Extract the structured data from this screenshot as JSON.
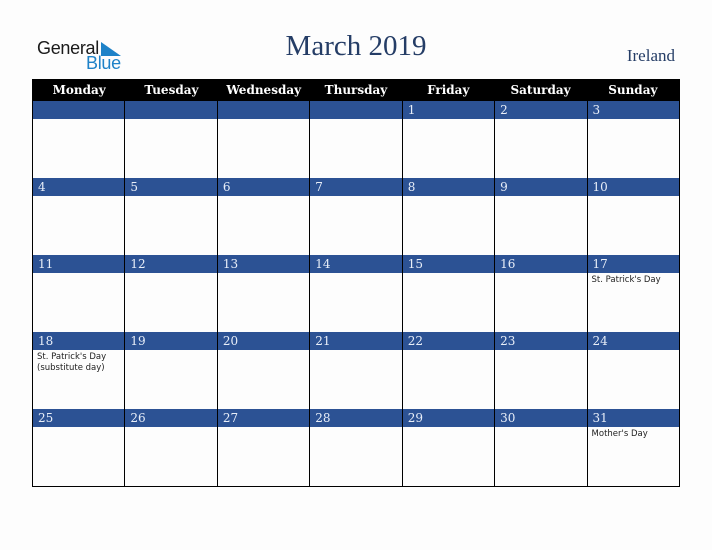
{
  "logo": {
    "line1": "General",
    "line2": "Blue"
  },
  "title": "March 2019",
  "country": "Ireland",
  "weekdays": [
    "Monday",
    "Tuesday",
    "Wednesday",
    "Thursday",
    "Friday",
    "Saturday",
    "Sunday"
  ],
  "colors": {
    "header_bg": "#000000",
    "day_bar": "#2c5294",
    "title": "#253d66",
    "logo_blue": "#1e82c8"
  },
  "weeks": [
    [
      {
        "day": "",
        "event": ""
      },
      {
        "day": "",
        "event": ""
      },
      {
        "day": "",
        "event": ""
      },
      {
        "day": "",
        "event": ""
      },
      {
        "day": "1",
        "event": ""
      },
      {
        "day": "2",
        "event": ""
      },
      {
        "day": "3",
        "event": ""
      }
    ],
    [
      {
        "day": "4",
        "event": ""
      },
      {
        "day": "5",
        "event": ""
      },
      {
        "day": "6",
        "event": ""
      },
      {
        "day": "7",
        "event": ""
      },
      {
        "day": "8",
        "event": ""
      },
      {
        "day": "9",
        "event": ""
      },
      {
        "day": "10",
        "event": ""
      }
    ],
    [
      {
        "day": "11",
        "event": ""
      },
      {
        "day": "12",
        "event": ""
      },
      {
        "day": "13",
        "event": ""
      },
      {
        "day": "14",
        "event": ""
      },
      {
        "day": "15",
        "event": ""
      },
      {
        "day": "16",
        "event": ""
      },
      {
        "day": "17",
        "event": "St. Patrick's Day"
      }
    ],
    [
      {
        "day": "18",
        "event": "St. Patrick's Day (substitute day)"
      },
      {
        "day": "19",
        "event": ""
      },
      {
        "day": "20",
        "event": ""
      },
      {
        "day": "21",
        "event": ""
      },
      {
        "day": "22",
        "event": ""
      },
      {
        "day": "23",
        "event": ""
      },
      {
        "day": "24",
        "event": ""
      }
    ],
    [
      {
        "day": "25",
        "event": ""
      },
      {
        "day": "26",
        "event": ""
      },
      {
        "day": "27",
        "event": ""
      },
      {
        "day": "28",
        "event": ""
      },
      {
        "day": "29",
        "event": ""
      },
      {
        "day": "30",
        "event": ""
      },
      {
        "day": "31",
        "event": "Mother's Day"
      }
    ]
  ]
}
